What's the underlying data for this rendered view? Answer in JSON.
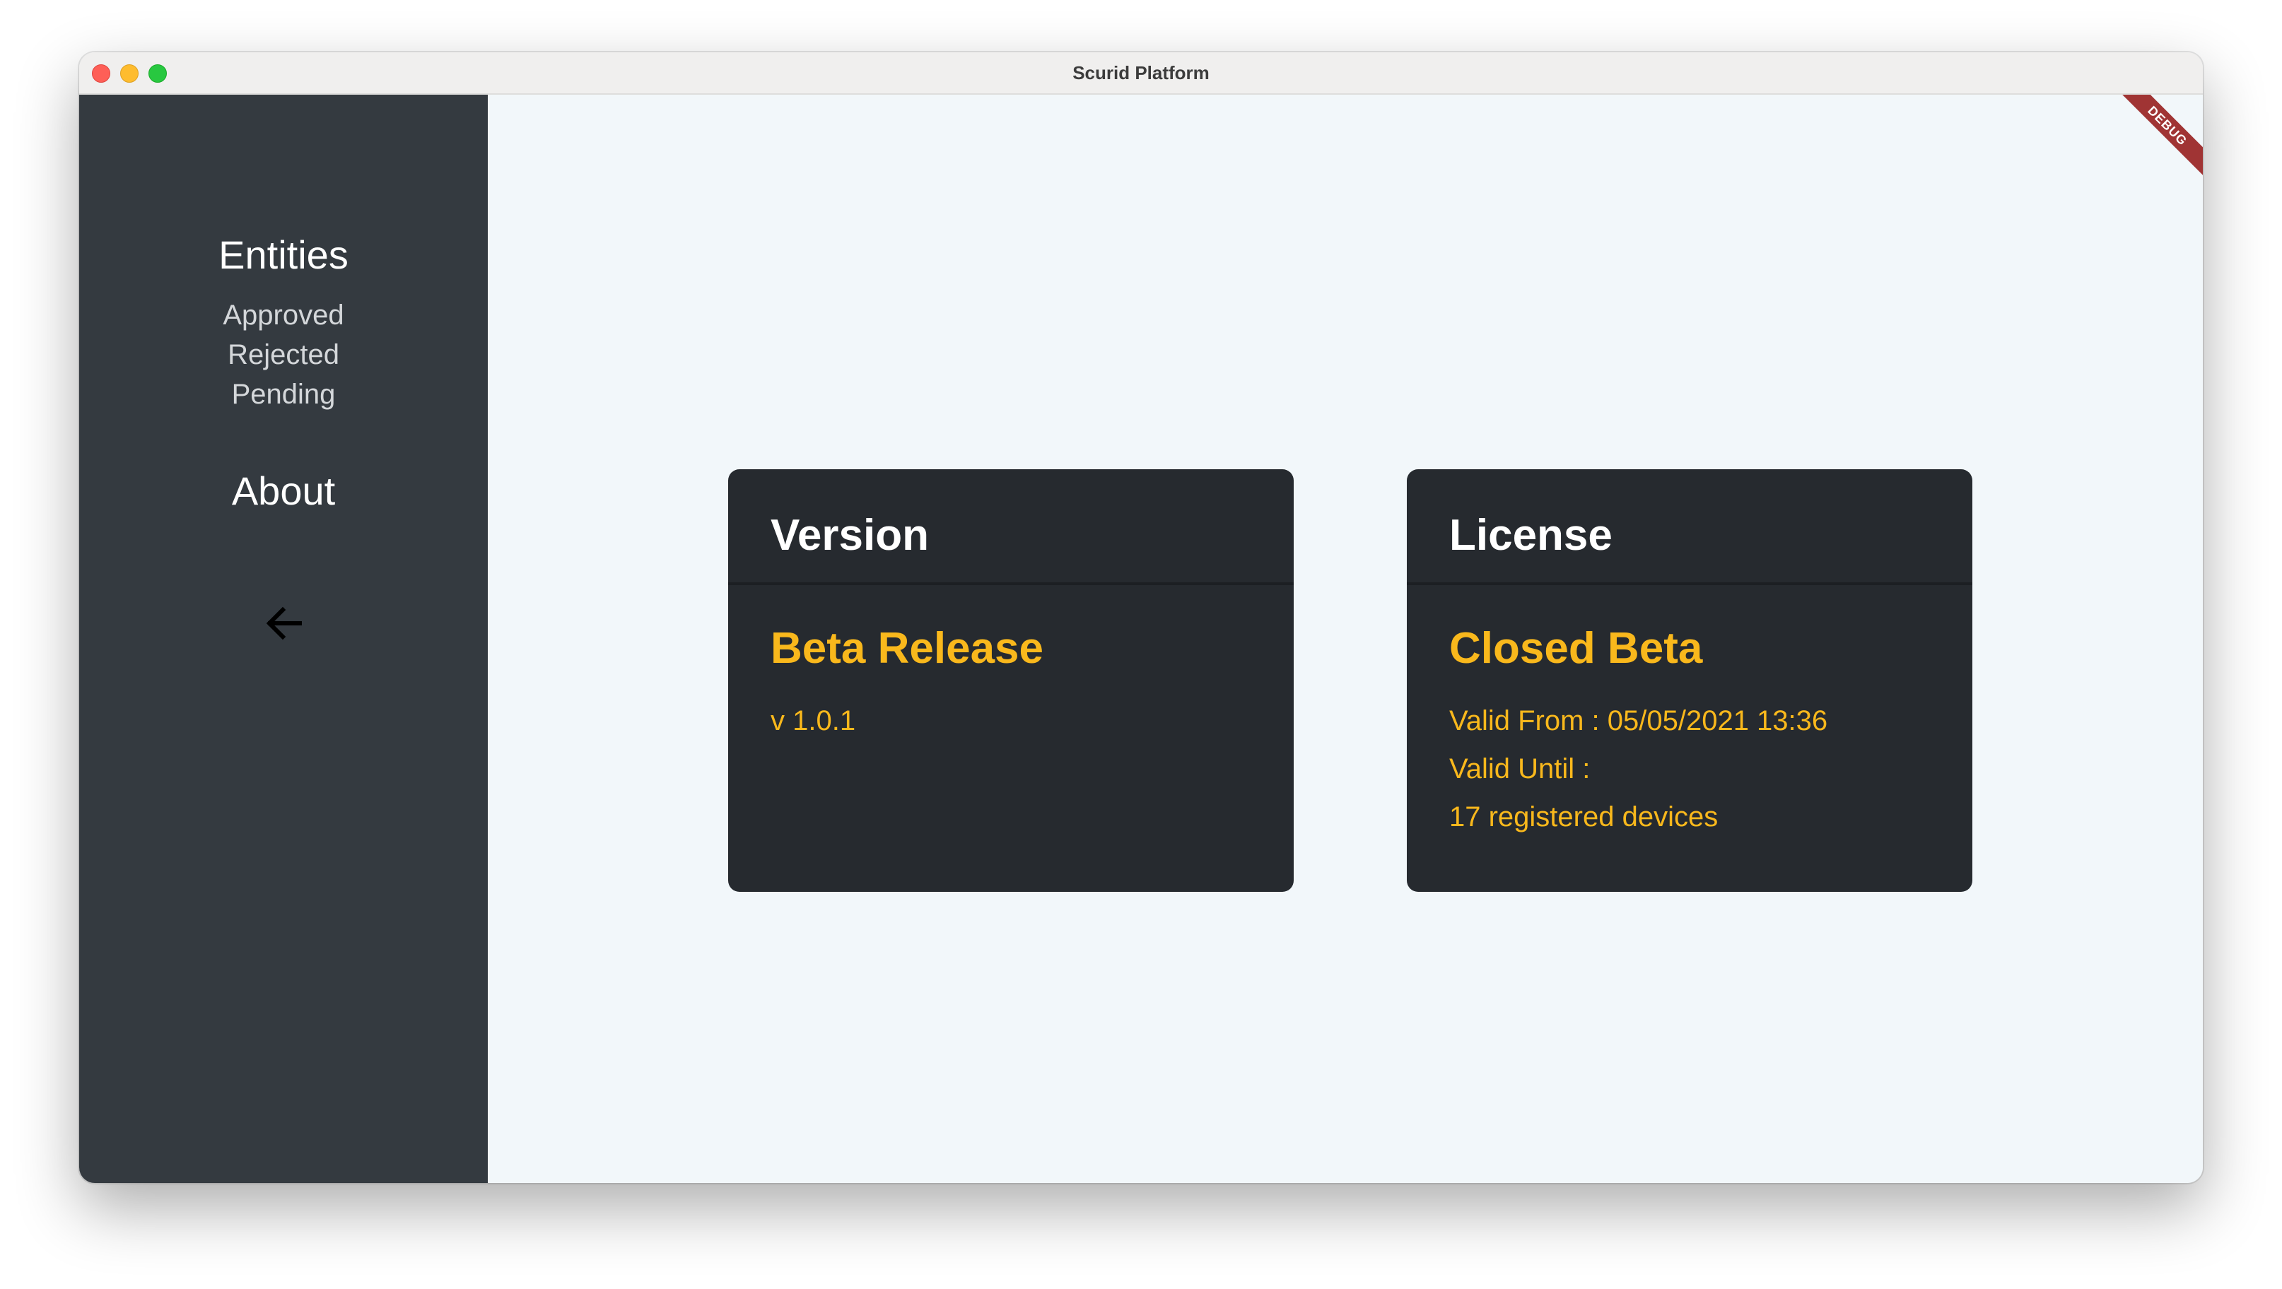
{
  "window": {
    "title": "Scurid Platform"
  },
  "sidebar": {
    "entities_heading": "Entities",
    "items": [
      {
        "label": "Approved"
      },
      {
        "label": "Rejected"
      },
      {
        "label": "Pending"
      }
    ],
    "about_heading": "About",
    "back_icon": "arrow-left-icon"
  },
  "debug_banner": "DEBUG",
  "cards": {
    "version": {
      "title": "Version",
      "subtitle": "Beta Release",
      "lines": [
        "v 1.0.1"
      ]
    },
    "license": {
      "title": "License",
      "subtitle": "Closed Beta",
      "lines": [
        "Valid From : 05/05/2021 13:36",
        "Valid Until :",
        "17 registered devices"
      ]
    }
  },
  "colors": {
    "sidebar_bg": "#343a40",
    "main_bg": "#f2f7fa",
    "card_bg": "#262a2f",
    "accent": "#f9b81c",
    "debug_ribbon": "#a03434"
  }
}
